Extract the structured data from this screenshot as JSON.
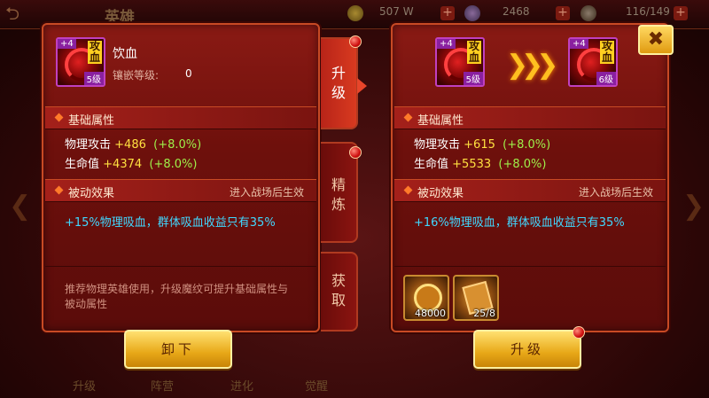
{
  "topbar": {
    "title": "英雄",
    "gold": "507 W",
    "diamond": "2468",
    "energy": "116/149",
    "plus": "+"
  },
  "bottom_tabs": [
    "升级",
    "阵营",
    "进化",
    "觉醒"
  ],
  "left": {
    "gem": {
      "plus": "+4",
      "tag": "攻血",
      "level": "5级"
    },
    "name": "饮血",
    "inlay_label": "镶嵌等级:",
    "inlay_value": "0",
    "basic_title": "基础属性",
    "stats": [
      {
        "label": "物理攻击",
        "value": "+486",
        "pct": "(+8.0%)"
      },
      {
        "label": "生命值",
        "value": "+4374",
        "pct": "(+8.0%)"
      }
    ],
    "passive_title": "被动效果",
    "passive_hint": "进入战场后生效",
    "effect": "+15%物理吸血，群体吸血收益只有35%",
    "desc": "推荐物理英雄使用，升级魔纹可提升基础属性与被动属性",
    "button": "卸下"
  },
  "tabs": [
    {
      "label": "升级",
      "active": true
    },
    {
      "label": "精炼",
      "active": false
    },
    {
      "label": "获取",
      "active": false
    }
  ],
  "right": {
    "gem_from": {
      "plus": "+4",
      "tag": "攻血",
      "level": "5级"
    },
    "gem_to": {
      "plus": "+4",
      "tag": "攻血",
      "level": "6级"
    },
    "chevrons": "❯❯❯",
    "close": "✖",
    "basic_title": "基础属性",
    "stats": [
      {
        "label": "物理攻击",
        "value": "+615",
        "pct": "(+8.0%)"
      },
      {
        "label": "生命值",
        "value": "+5533",
        "pct": "(+8.0%)"
      }
    ],
    "passive_title": "被动效果",
    "passive_hint": "进入战场后生效",
    "effect": "+16%物理吸血，群体吸血收益只有35%",
    "materials": [
      {
        "icon": "gold-coin-icon",
        "qty": "48000"
      },
      {
        "icon": "scroll-icon",
        "qty": "25/8"
      }
    ],
    "button": "升级"
  }
}
